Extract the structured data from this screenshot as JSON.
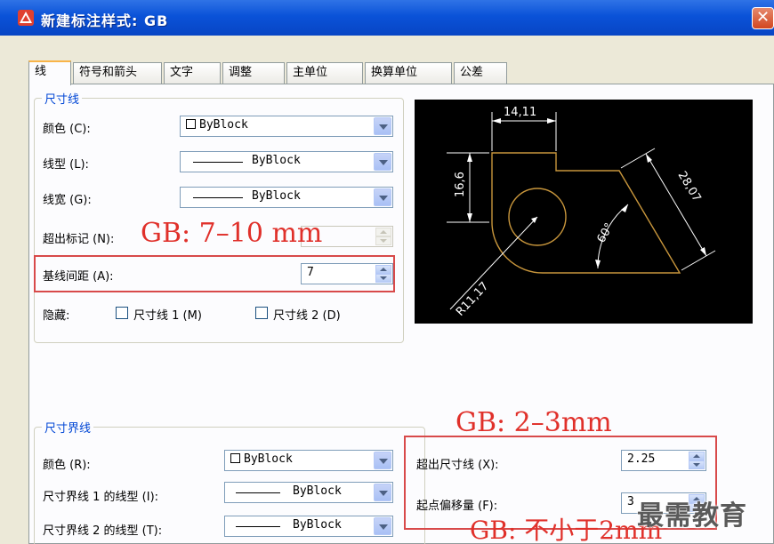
{
  "window": {
    "title": "新建标注样式: GB",
    "close_glyph": "✕"
  },
  "tabs": [
    "线",
    "符号和箭头",
    "文字",
    "调整",
    "主单位",
    "换算单位",
    "公差"
  ],
  "dimension_lines": {
    "legend": "尺寸线",
    "color_label": "颜色 (C):",
    "color_value": "ByBlock",
    "linetype_label": "线型 (L):",
    "linetype_value": "ByBlock",
    "lineweight_label": "线宽 (G):",
    "lineweight_value": "ByBlock",
    "extend_beyond_ticks_label": "超出标记 (N):",
    "extend_beyond_ticks_value": "",
    "baseline_spacing_label": "基线间距 (A):",
    "baseline_spacing_value": "7",
    "suppress_label": "隐藏:",
    "suppress_dim1_label": "尺寸线 1 (M)",
    "suppress_dim2_label": "尺寸线 2 (D)"
  },
  "extension_lines": {
    "legend": "尺寸界线",
    "color_label": "颜色 (R):",
    "color_value": "ByBlock",
    "linetype1_label": "尺寸界线 1 的线型 (I):",
    "linetype1_value": "ByBlock",
    "linetype2_label": "尺寸界线 2 的线型 (T):",
    "linetype2_value": "ByBlock",
    "extend_beyond_dim_label": "超出尺寸线 (X):",
    "extend_beyond_dim_value": "2.25",
    "offset_from_origin_label": "起点偏移量 (F):",
    "offset_from_origin_value": "3"
  },
  "annotations": {
    "baseline": "GB: 7–10 mm",
    "extension": "GB: 2–3mm",
    "offset": "GB: 不小于2mm"
  },
  "preview": {
    "dim_top": "14,11",
    "dim_left": "16,6",
    "dim_right": "28,07",
    "dim_angle": "60°",
    "dim_radius": "R11,17"
  },
  "watermark": "最需教育",
  "colors": {
    "titlebar": "#0a52d8",
    "annotation_red": "#e0302a",
    "tab_accent": "#f9b448",
    "preview_bg": "#000000",
    "preview_geometry": "#c8963c",
    "preview_dims": "#ffffff"
  }
}
